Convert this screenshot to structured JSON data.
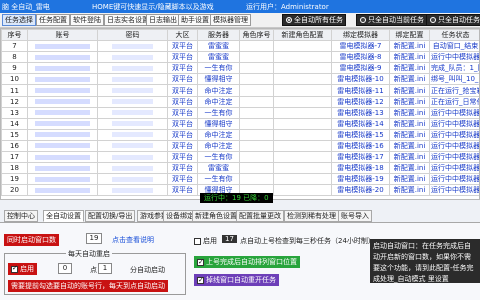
{
  "window": {
    "title_left": "脑 全自动_雷电",
    "title_mid": "HOME键可快速显示/隐藏脚本以及游戏",
    "title_right": "运行用户：Administrator"
  },
  "toolbar": {
    "buttons": [
      "任务选择",
      "任务配置",
      "软件登陆",
      "日志实名设置",
      "日志输出",
      "助手设置",
      "模拟器管理"
    ],
    "radio_options": [
      "全自动所有任务",
      "只全自动当前任务",
      "只全自动任务任务"
    ]
  },
  "grid": {
    "columns": [
      "序号",
      "账号",
      "密码",
      "大区",
      "服务器",
      "角色序号",
      "新建角色配置",
      "绑定模拟器",
      "绑定配置",
      "任务状态"
    ],
    "rows": [
      [
        "7",
        "",
        "",
        "双平台",
        "雷蜜蜜",
        "",
        "",
        "雷电模拟器-7",
        "新配置.ini",
        "自动窗口_结束"
      ],
      [
        "8",
        "",
        "",
        "双平台",
        "雷蜜蜜",
        "",
        "",
        "雷电模拟器-8",
        "新配置.ini",
        "运行中中模拟器数量达"
      ],
      [
        "9",
        "",
        "",
        "双平台",
        "一生有你",
        "",
        "",
        "雷电模拟器-9",
        "新配置.ini",
        "完成_队员：1_队_0_5"
      ],
      [
        "10",
        "",
        "",
        "双平台",
        "懂得相守",
        "",
        "",
        "雷电模拟器-10",
        "新配置.ini",
        "绑号_叫叫_10_10"
      ],
      [
        "11",
        "",
        "",
        "双平台",
        "命中注定",
        "",
        "",
        "雷电模拟器-11",
        "新配置.ini",
        "正在运行_抢宝箱"
      ],
      [
        "12",
        "",
        "",
        "双平台",
        "命中注定",
        "",
        "",
        "雷电模拟器-12",
        "新配置.ini",
        "正在运行_日常任务"
      ],
      [
        "13",
        "",
        "",
        "双平台",
        "一生有你",
        "",
        "",
        "雷电模拟器-13",
        "新配置.ini",
        "运行中中模拟器数量达"
      ],
      [
        "14",
        "",
        "",
        "双平台",
        "懂得相守",
        "",
        "",
        "雷电模拟器-14",
        "新配置.ini",
        "运行中中模拟器数量达"
      ],
      [
        "15",
        "",
        "",
        "双平台",
        "命中注定",
        "",
        "",
        "雷电模拟器-15",
        "新配置.ini",
        "运行中中模拟器数量达"
      ],
      [
        "16",
        "",
        "",
        "双平台",
        "命中注定",
        "",
        "",
        "雷电模拟器-16",
        "新配置.ini",
        "运行中中模拟器数量达"
      ],
      [
        "17",
        "",
        "",
        "双平台",
        "一生有你",
        "",
        "",
        "雷电模拟器-17",
        "新配置.ini",
        "运行中中模拟器数量达"
      ],
      [
        "18",
        "",
        "",
        "双平台",
        "雷蜜蜜",
        "",
        "",
        "雷电模拟器-18",
        "新配置.ini",
        "运行中中模拟器数量达"
      ],
      [
        "19",
        "",
        "",
        "双平台",
        "一生有你",
        "",
        "",
        "雷电模拟器-19",
        "新配置.ini",
        "运行中中模拟器数量达"
      ],
      [
        "20",
        "",
        "",
        "双平台",
        "懂得相守",
        "",
        "",
        "雷电模拟器-20",
        "新配置.ini",
        "运行中中模拟器数量达"
      ]
    ]
  },
  "status": {
    "text": "运行中：19 已降：0"
  },
  "bottom_tabs": [
    "控制中心",
    "全自动设置",
    "配置切换/导出",
    "游戏参数",
    "设备绑定",
    "新建角色设置",
    "配置批量更改",
    "检测到稀有处理",
    "账号导入"
  ],
  "auto_settings": {
    "max_window_label": "同时启动窗口数",
    "max_window_value": "19",
    "max_window_link": "点击查看说明",
    "daily_group_title": "每天自动重启",
    "enable_label": "启用",
    "hour_value": "0",
    "hour_unit": "点",
    "minute_value": "1",
    "minute_unit": "分",
    "action_label": "自动启动",
    "note": "需要提前勾选要自动的账号行，每天到点自动启动",
    "enable2_label": "启用",
    "interval_value": "17",
    "interval_text": "点自动上号检查到每三秒任务（24小时制）",
    "option1": "上号完成后自动排列窗口位置",
    "option2": "掉线窗口自动重开任务",
    "info_text": "启动自动窗口：在任务完成后自动开启新的窗口数，如果你不需要这个功能，请到此配置-任务完成处理_自动模式 里设置"
  },
  "colors": {
    "title_bar": "#1f74e0",
    "accent_red": "#c81212",
    "link_blue": "#1a4fd8",
    "status_green": "#38d438"
  }
}
